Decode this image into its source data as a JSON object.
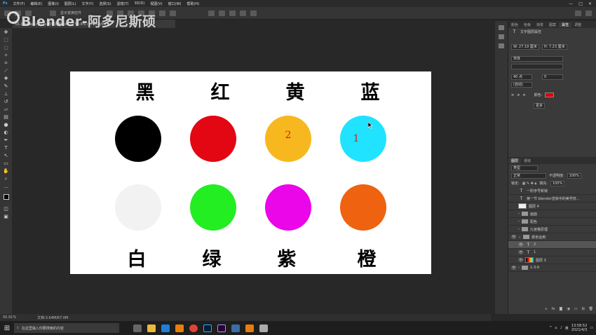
{
  "menubar": {
    "items": [
      "文件(F)",
      "编辑(E)",
      "图像(I)",
      "图层(L)",
      "文字(Y)",
      "选择(S)",
      "滤镜(T)",
      "3D(D)",
      "视图(V)",
      "窗口(W)",
      "帮助(H)"
    ]
  },
  "optbar": {
    "auto_select_label": "显示变换控件"
  },
  "document_tab": {
    "title": "01.blender-cycles-教学视频.psd @ 50.9% (1, RGB/8#)"
  },
  "watermark": {
    "text": "Blender-阿多尼斯硕"
  },
  "canvas": {
    "labels": [
      "黑",
      "红",
      "黄",
      "蓝",
      "白",
      "绿",
      "紫",
      "橙"
    ],
    "circle_colors": [
      "#000000",
      "#e30613",
      "#f7b81f",
      "#1fe3ff",
      "#f2f2f2",
      "#22ee22",
      "#ea06e8",
      "#ef6210"
    ],
    "circle_numbers": {
      "yellow": "2",
      "cyan": "1"
    }
  },
  "statusbar": {
    "zoom": "50.91%",
    "doc_info": "文档:3.64M/67.0M"
  },
  "right_panel": {
    "tabs": [
      "颜色",
      "色板",
      "渐变",
      "图案",
      "属性",
      "调整"
    ],
    "active_tab": "属性",
    "title": "文字图层属性",
    "w": "W: 27.19 厘米",
    "h": "H: 7.23 厘米",
    "font_family": "宋体",
    "font_size": "40 点",
    "leading": "(自动)",
    "tracking": "0",
    "color_label": "颜色:",
    "more_label": "更多"
  },
  "layers_panel": {
    "tabs": [
      "图层",
      "通道"
    ],
    "filter": "类型",
    "blend": "正常",
    "opacity_label": "不透明度:",
    "opacity": "100%",
    "fill_label": "填充:",
    "fill": "100%",
    "lock_label": "锁定:",
    "layers": [
      {
        "type": "text",
        "name": "一阶序号新锁"
      },
      {
        "type": "text",
        "name": "第一节 blender渲染中的美学技..."
      },
      {
        "type": "image",
        "name": "图层 4"
      },
      {
        "type": "folder",
        "name": "画面"
      },
      {
        "type": "folder",
        "name": "配色"
      },
      {
        "type": "folder",
        "name": "九宫格原理"
      },
      {
        "type": "folder",
        "name": "颜色运用"
      },
      {
        "type": "text",
        "name": "2",
        "selected": true
      },
      {
        "type": "text",
        "name": "1"
      },
      {
        "type": "image",
        "name": "图层 3"
      },
      {
        "type": "folder",
        "name": "1-3-6"
      }
    ]
  },
  "taskbar": {
    "search_placeholder": "在这里输入你要搜索的内容",
    "time": "13:58:52",
    "date": "2021/4/3",
    "ime": "英"
  },
  "colors": {
    "accent": "#e00000",
    "panel_bg": "#3a3a3a",
    "canvas_bg": "#282828"
  }
}
